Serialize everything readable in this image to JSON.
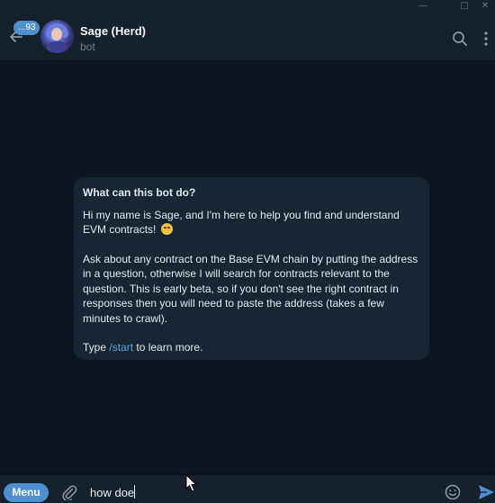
{
  "window": {
    "minimize_glyph": "—",
    "maximize_glyph": "□",
    "close_glyph": "✕"
  },
  "header": {
    "back_icon": "back-arrow-icon",
    "unread_badge": "...93",
    "chat_title": "Sage (Herd)",
    "chat_subtitle": "bot",
    "search_icon": "search-icon",
    "more_icon": "more-vertical-icon"
  },
  "info_card": {
    "title": "What can this bot do?",
    "para1": "Hi my name is Sage, and I'm here to help you find and understand EVM contracts!",
    "para1_emoji": "smiling-face-emoji",
    "para2": "Ask about any contract on the Base EVM chain by putting the address in a question, otherwise I will search for contracts relevant to the question. This is early beta, so if you don't see the right contract in responses then you will need to paste the address (takes a few minutes to crawl).",
    "para3_prefix": "Type ",
    "para3_link": "/start",
    "para3_suffix": " to learn more."
  },
  "composer": {
    "menu_label": "Menu",
    "attach_icon": "paperclip-icon",
    "input_value": "how doe",
    "emoji_icon": "smiley-icon",
    "send_icon": "send-icon"
  },
  "colors": {
    "background": "#0e1621",
    "header": "#17212b",
    "card": "#182533",
    "accent": "#4e8fcf",
    "link": "#5ea5e3"
  }
}
